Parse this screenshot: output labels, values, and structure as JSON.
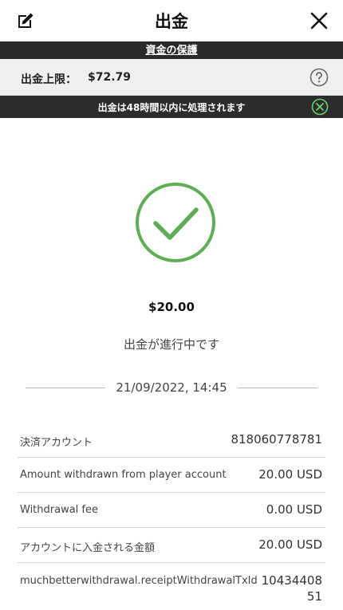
{
  "header": {
    "title": "出金",
    "edit_icon": "edit-icon",
    "close_icon": "close-icon"
  },
  "protection_link": "資金の保護",
  "limit": {
    "label": "出金上限：",
    "value": "$72.79",
    "help_icon": "help-icon"
  },
  "notice": {
    "text": "出金は48時間以内に処理されます",
    "dismiss_icon": "close-circle-icon",
    "accent": "#6bd06b"
  },
  "result": {
    "icon": "check-circle-icon",
    "color": "#5fad56",
    "amount": "$20.00",
    "status": "出金が進行中です",
    "datetime": "21/09/2022, 14:45"
  },
  "details": [
    {
      "label": "決済アカウント",
      "value": "818060778781"
    },
    {
      "label": "Amount withdrawn from player account",
      "value": "20.00 USD"
    },
    {
      "label": "Withdrawal fee",
      "value": "0.00 USD"
    },
    {
      "label": "アカウントに入金される金額",
      "value": "20.00 USD"
    },
    {
      "label": "muchbetterwithdrawal.receiptWithdrawalTxId",
      "value": "1043440851"
    }
  ]
}
